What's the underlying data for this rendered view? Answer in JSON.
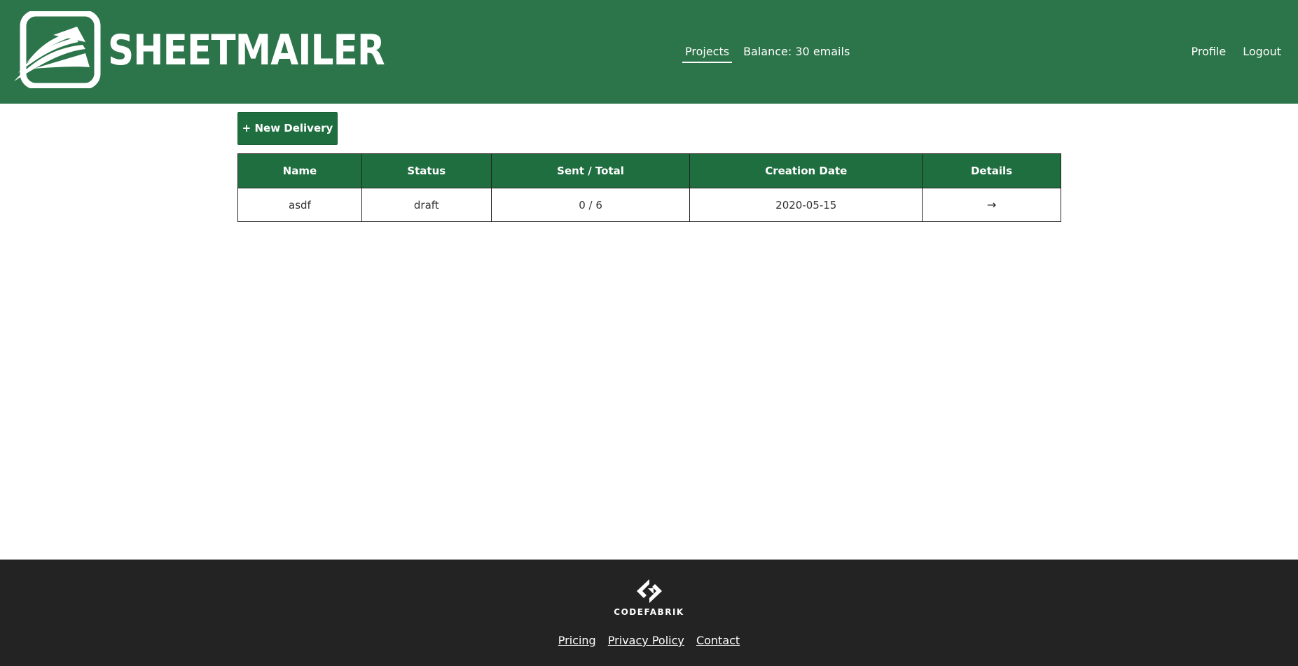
{
  "header": {
    "brand_name": "SHEETMAILER",
    "nav": {
      "projects_label": "Projects",
      "balance_text": "Balance: 30 emails",
      "profile_label": "Profile",
      "logout_label": "Logout"
    }
  },
  "main": {
    "new_delivery_label": "+ New Delivery",
    "table": {
      "columns": [
        "Name",
        "Status",
        "Sent / Total",
        "Creation Date",
        "Details"
      ],
      "rows": [
        {
          "name": "asdf",
          "status": "draft",
          "sent_total": "0 / 6",
          "creation_date": "2020-05-15",
          "details": "→"
        }
      ]
    }
  },
  "footer": {
    "brand": "CODEFABRIK",
    "links": {
      "pricing": "Pricing",
      "privacy": "Privacy Policy",
      "contact": "Contact"
    }
  },
  "colors": {
    "header_bg": "#2c7449",
    "button_bg": "#1f6e40",
    "footer_bg": "#232323"
  },
  "icons": {
    "logo": "sheetmailer-logo-icon",
    "footer_logo": "codefabrik-logo-icon",
    "details_arrow": "arrow-right-icon"
  }
}
